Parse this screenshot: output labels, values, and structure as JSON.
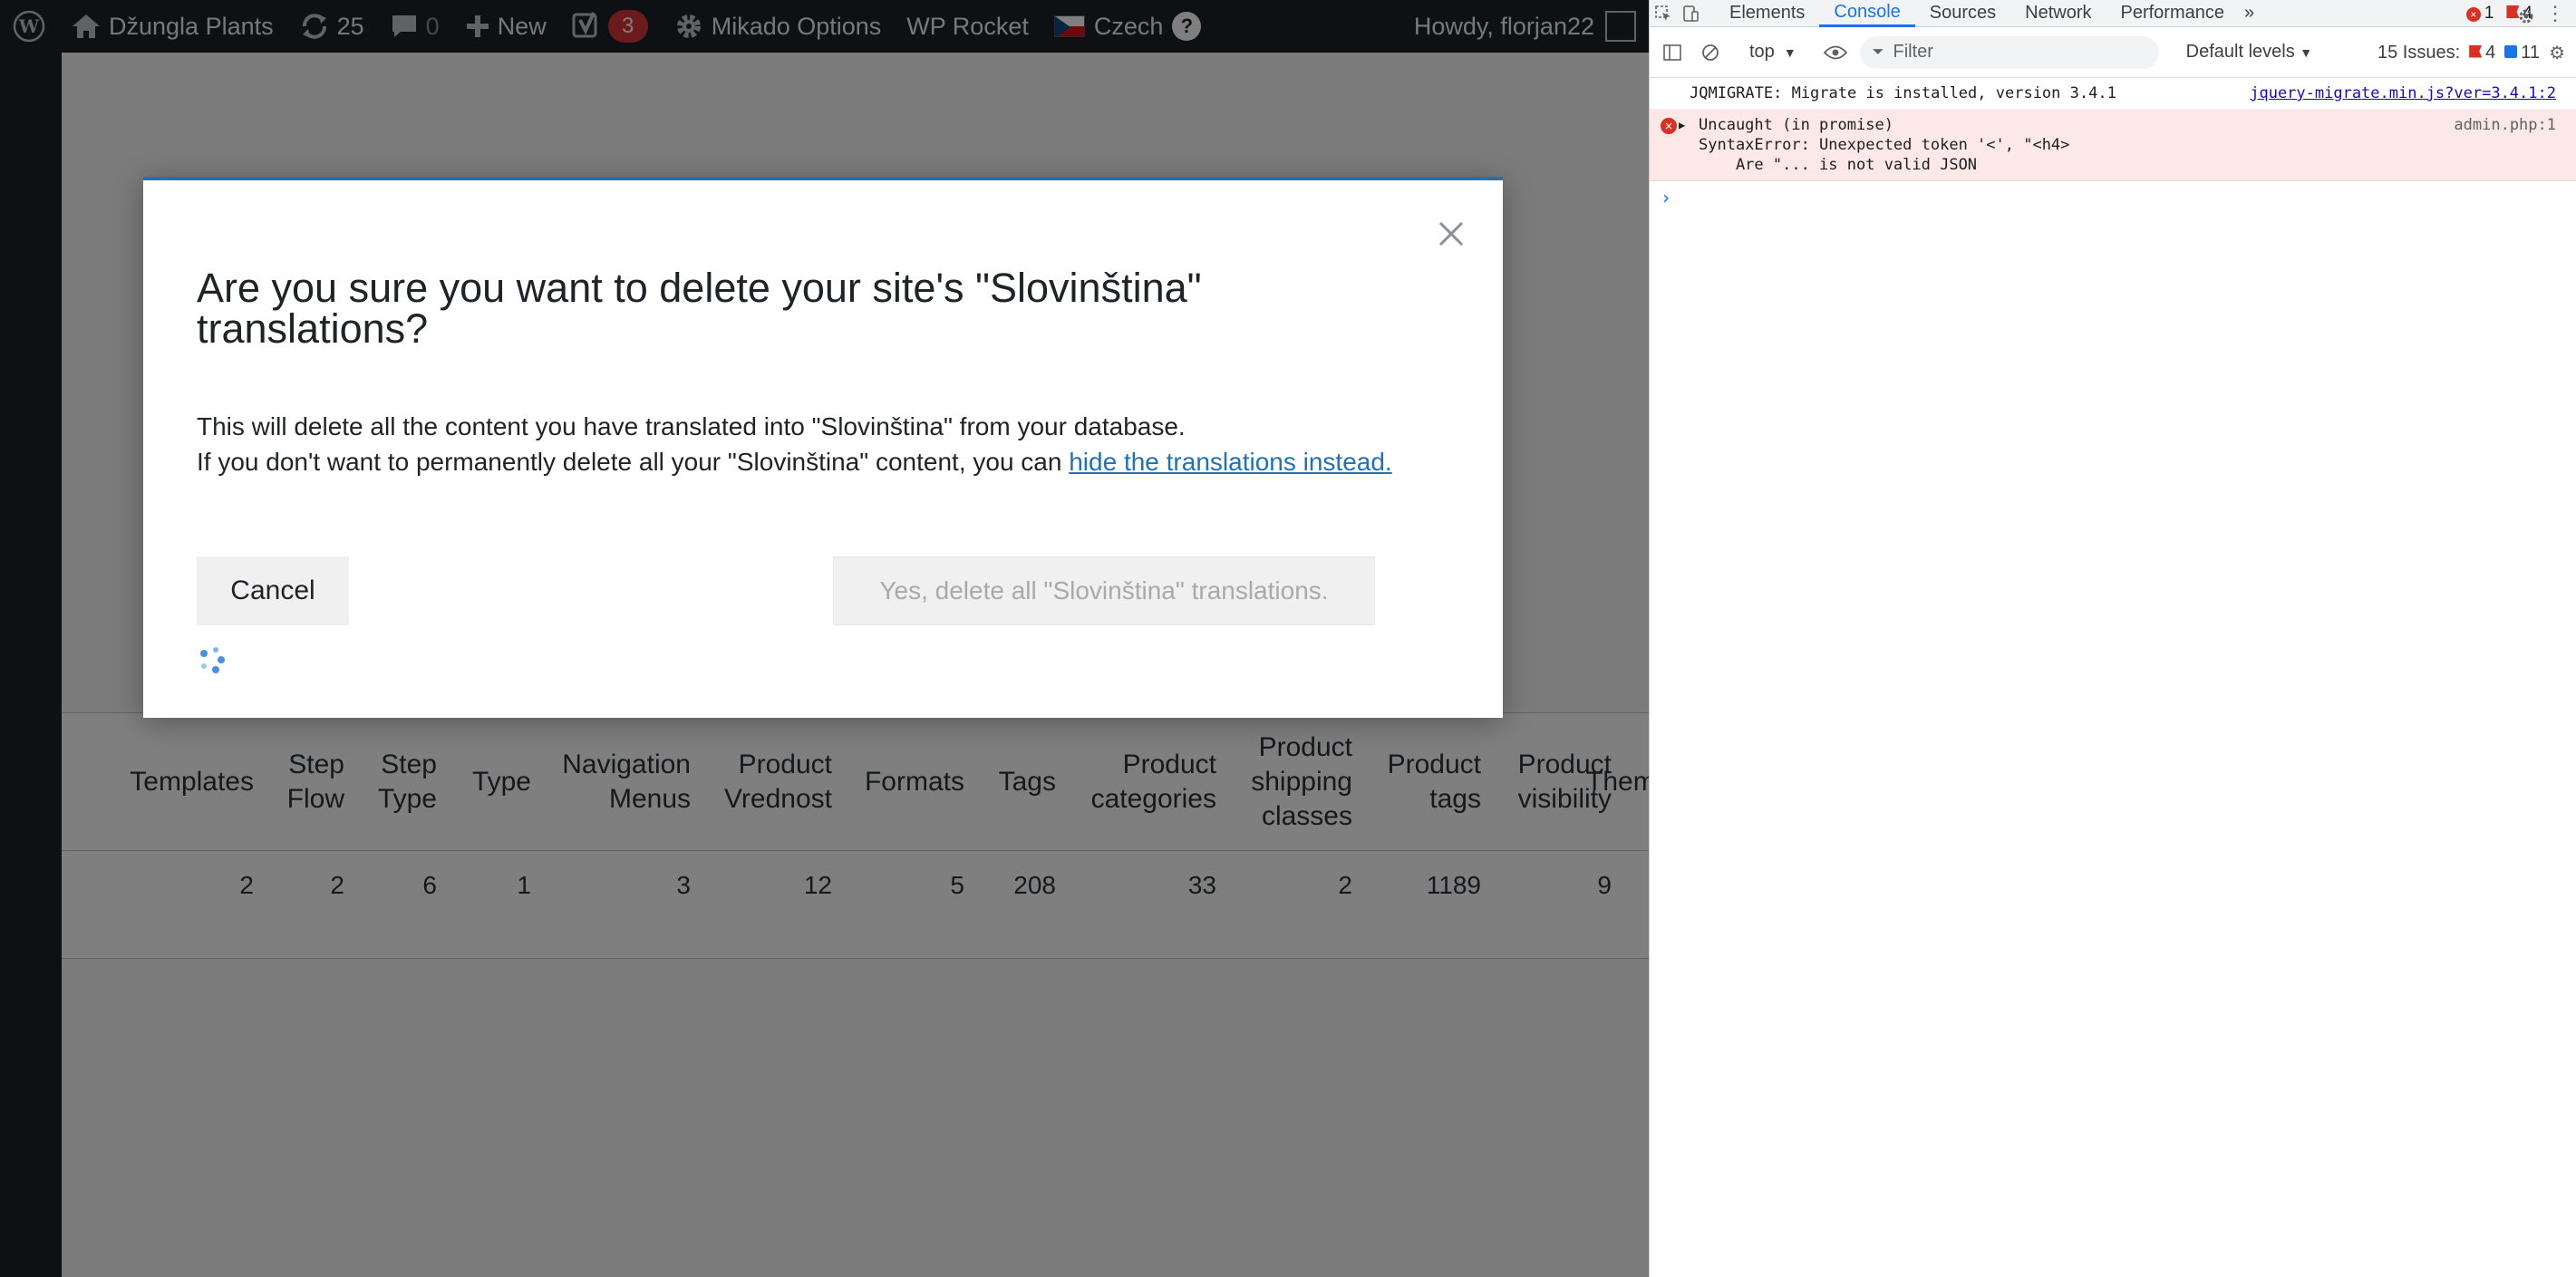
{
  "admin_bar": {
    "site_name": "Džungla Plants",
    "updates_count": "25",
    "comments_count": "0",
    "new_label": "New",
    "yoast_count": "3",
    "mikado_label": "Mikado Options",
    "wp_rocket_label": "WP Rocket",
    "language_label": "Czech",
    "help_glyph": "?",
    "howdy_text": "Howdy, florjan22"
  },
  "table": {
    "headers": [
      {
        "key": "templates",
        "lines": [
          "Templates"
        ]
      },
      {
        "key": "step-flow",
        "lines": [
          "Step",
          "Flow"
        ]
      },
      {
        "key": "step-type",
        "lines": [
          "Step",
          "Type"
        ]
      },
      {
        "key": "type",
        "lines": [
          "Type"
        ]
      },
      {
        "key": "navigation-menus",
        "lines": [
          "Navigation",
          "Menus"
        ]
      },
      {
        "key": "product-vrednost",
        "lines": [
          "Product",
          "Vrednost"
        ]
      },
      {
        "key": "formats",
        "lines": [
          "Formats"
        ]
      },
      {
        "key": "tags",
        "lines": [
          "Tags"
        ]
      },
      {
        "key": "product-categories",
        "lines": [
          "Product",
          "categories"
        ]
      },
      {
        "key": "product-shipping-classes",
        "lines": [
          "Product",
          "shipping",
          "classes"
        ]
      },
      {
        "key": "product-tags",
        "lines": [
          "Product",
          "tags"
        ]
      },
      {
        "key": "product-visibility",
        "lines": [
          "Product",
          "visibility"
        ]
      },
      {
        "key": "themes",
        "lines": [
          "Them"
        ]
      }
    ],
    "values": [
      "2",
      "2",
      "6",
      "1",
      "3",
      "12",
      "5",
      "208",
      "33",
      "2",
      "1189",
      "9",
      ""
    ]
  },
  "modal": {
    "title": "Are you sure you want to delete your site's \"Slovinština\" translations?",
    "line1": "This will delete all the content you have translated into \"Slovinština\" from your database.",
    "line2_prefix": "If you don't want to permanently delete all your \"Slovinština\" content, you can ",
    "line2_link": "hide the translations instead.",
    "cancel_label": "Cancel",
    "delete_label": "Yes, delete all \"Slovinština\" translations."
  },
  "devtools": {
    "tabs": [
      "Elements",
      "Console",
      "Sources",
      "Network",
      "Performance"
    ],
    "active_tab": "Console",
    "more_tabs_glyph": "»",
    "error_count": "1",
    "warning_count": "4",
    "context": "top",
    "filter_placeholder": "Filter",
    "levels_label": "Default levels",
    "issues_label": "15 Issues:",
    "issues_warn": "4",
    "issues_info": "11",
    "logs": [
      {
        "type": "log",
        "text": "JQMIGRATE: Migrate is installed, version 3.4.1",
        "source": "jquery-migrate.min.js?ver=3.4.1:2"
      },
      {
        "type": "error",
        "text": "Uncaught (in promise)\nSyntaxError: Unexpected token '<', \"<h4>\n    Are \"... is not valid JSON",
        "source": "admin.php:1"
      }
    ],
    "prompt_glyph": "›"
  },
  "colors": {
    "admin_bar_bg": "#1d2327",
    "link_blue": "#2271b1",
    "bubble_red": "#d63638",
    "devtools_active": "#1a73e8"
  }
}
